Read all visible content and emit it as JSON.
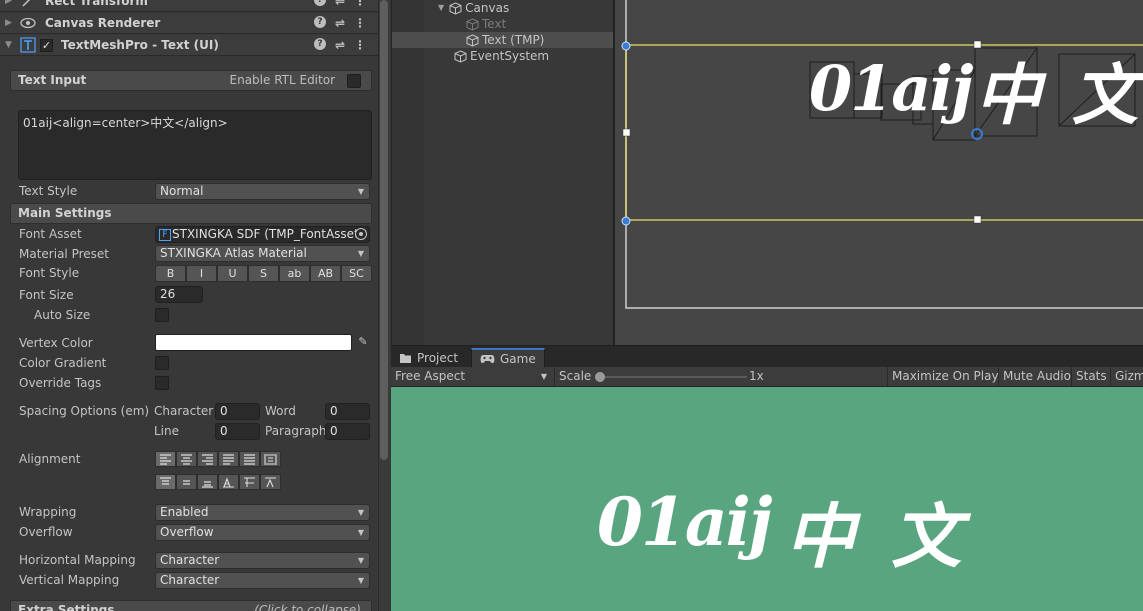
{
  "inspector": {
    "components": {
      "rect_transform": "Rect Transform",
      "canvas_renderer": "Canvas Renderer",
      "tmp_text": "TextMeshPro - Text (UI)"
    },
    "text_input": {
      "header": "Text Input",
      "rtl_label": "Enable RTL Editor",
      "value": "01aij<align=center>中文</align>"
    },
    "text_style": {
      "label": "Text Style",
      "value": "Normal"
    },
    "main_settings": {
      "header": "Main Settings",
      "font_asset_label": "Font Asset",
      "font_asset_value": "STXINGKA SDF (TMP_FontAsset)",
      "material_preset_label": "Material Preset",
      "material_preset_value": "STXINGKA Atlas Material",
      "font_style_label": "Font Style",
      "font_style_buttons": [
        "B",
        "I",
        "U",
        "S",
        "ab",
        "AB",
        "SC"
      ],
      "font_size_label": "Font Size",
      "font_size_value": "26",
      "auto_size_label": "Auto Size",
      "vertex_color_label": "Vertex Color",
      "vertex_color": "#ffffff",
      "color_gradient_label": "Color Gradient",
      "override_tags_label": "Override Tags",
      "spacing_label": "Spacing Options (em)",
      "spacing": {
        "character_label": "Character",
        "character_value": "0",
        "word_label": "Word",
        "word_value": "0",
        "line_label": "Line",
        "line_value": "0",
        "paragraph_label": "Paragraph",
        "paragraph_value": "0"
      },
      "alignment_label": "Alignment",
      "wrapping_label": "Wrapping",
      "wrapping_value": "Enabled",
      "overflow_label": "Overflow",
      "overflow_value": "Overflow",
      "horizontal_mapping_label": "Horizontal Mapping",
      "horizontal_mapping_value": "Character",
      "vertical_mapping_label": "Vertical Mapping",
      "vertical_mapping_value": "Character"
    },
    "extra_settings": {
      "header": "Extra Settings",
      "hint": "(Click to collapse)"
    }
  },
  "hierarchy": {
    "items": [
      {
        "label": "Canvas"
      },
      {
        "label": "Text"
      },
      {
        "label": "Text (TMP)"
      },
      {
        "label": "EventSystem"
      }
    ]
  },
  "scene": {
    "text_latin": "01aij",
    "text_cjk": "中 文"
  },
  "game_panel": {
    "tabs": {
      "project": "Project",
      "game": "Game"
    },
    "aspect": "Free Aspect",
    "scale_label": "Scale",
    "scale_value": "1x",
    "maximize": "Maximize On Play",
    "mute": "Mute Audio",
    "stats": "Stats",
    "gizmos": "Gizmos",
    "background_color": "#58a580",
    "text_latin": "01aij",
    "text_cjk": "中 文"
  }
}
